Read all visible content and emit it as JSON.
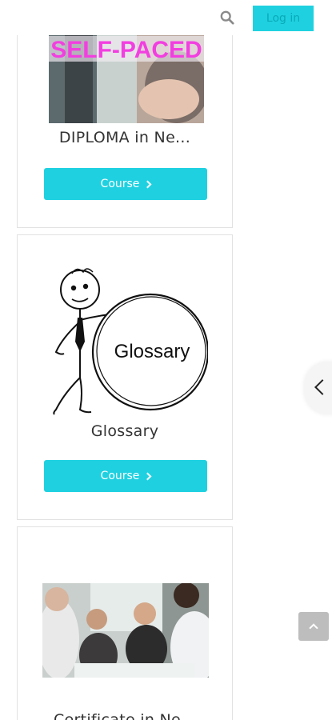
{
  "header": {
    "login_label": "Log in"
  },
  "cards": [
    {
      "banner_text": "SELF-PACED",
      "title": "DIPLOMA in Ne...",
      "button_label": "Course"
    },
    {
      "image_text": "Glossary",
      "title": "Glossary",
      "button_label": "Course"
    },
    {
      "title": "Certificate in Ne..."
    }
  ],
  "colors": {
    "accent": "#1fd1e0",
    "banner_text": "#f23fe0"
  }
}
